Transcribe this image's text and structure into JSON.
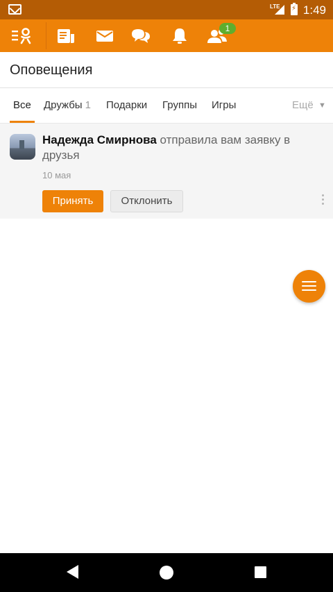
{
  "status_bar": {
    "time": "1:49",
    "network": "LTE"
  },
  "top_nav": {
    "friends_badge": "1",
    "icons": [
      "ok-menu-icon",
      "feed-icon",
      "messages-icon",
      "discussions-icon",
      "notifications-icon",
      "friends-icon"
    ]
  },
  "header": {
    "title": "Оповещения"
  },
  "tabs": [
    {
      "label": "Все"
    },
    {
      "label": "Дружбы",
      "count": "1"
    },
    {
      "label": "Подарки"
    },
    {
      "label": "Группы"
    },
    {
      "label": "Игры"
    },
    {
      "label": "Ещё"
    }
  ],
  "notification": {
    "name": "Надежда Смирнова",
    "text": "отправила вам заявку в друзья",
    "date": "10 мая",
    "accept_label": "Принять",
    "decline_label": "Отклонить"
  },
  "colors": {
    "accent": "#ee8208",
    "status_bar": "#b45c05",
    "badge": "#5fae2e"
  }
}
